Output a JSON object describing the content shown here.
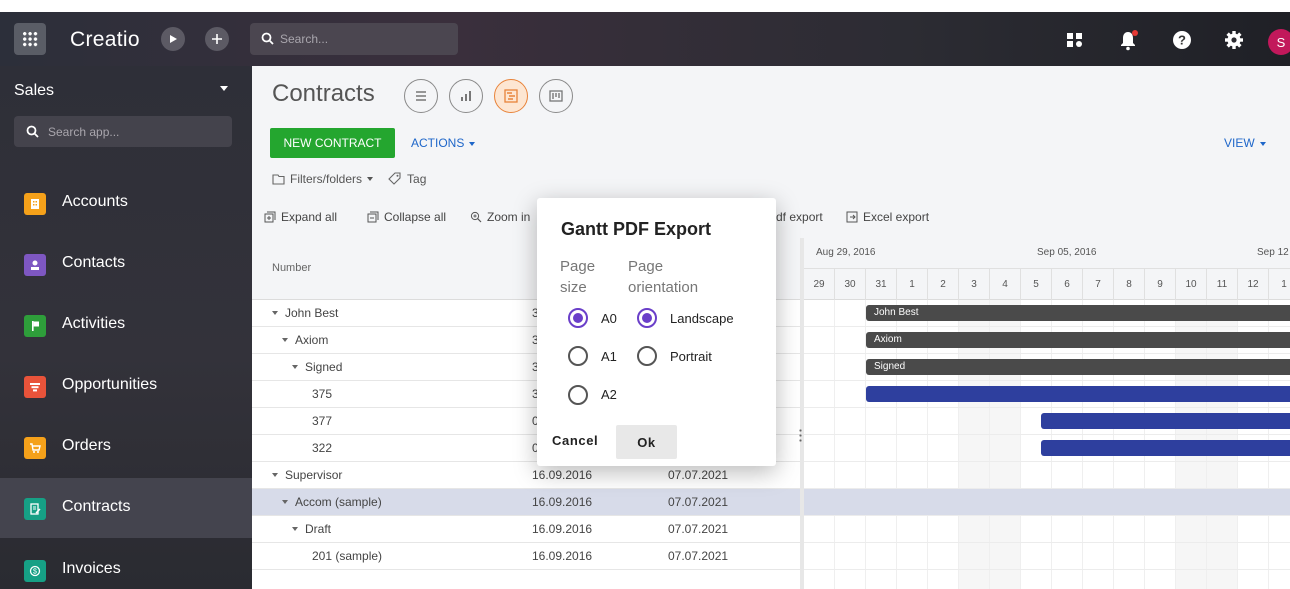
{
  "topbar": {
    "logo": "Creatio",
    "search_placeholder": "Search...",
    "avatar_initial": "S"
  },
  "sidebar": {
    "workspace": "Sales",
    "search_placeholder": "Search app...",
    "items": [
      {
        "label": "Accounts",
        "color": "#f5a11a",
        "icon": "building-icon"
      },
      {
        "label": "Contacts",
        "color": "#7e57c2",
        "icon": "person-icon"
      },
      {
        "label": "Activities",
        "color": "#2e9e3a",
        "icon": "flag-icon"
      },
      {
        "label": "Opportunities",
        "color": "#e8533a",
        "icon": "funnel-icon"
      },
      {
        "label": "Orders",
        "color": "#f5a11a",
        "icon": "cart-icon"
      },
      {
        "label": "Contracts",
        "color": "#16a085",
        "icon": "contract-icon"
      },
      {
        "label": "Invoices",
        "color": "#16a085",
        "icon": "invoice-icon"
      }
    ],
    "active": "Contracts"
  },
  "main": {
    "title": "Contracts",
    "new_button": "NEW CONTRACT",
    "actions": "ACTIONS",
    "view": "VIEW",
    "filters": "Filters/folders",
    "tag": "Tag",
    "toolbar": {
      "expand_all": "Expand all",
      "collapse_all": "Collapse all",
      "zoom_in": "Zoom in",
      "pdf_export": "df export",
      "excel_export": "Excel export"
    },
    "table": {
      "column_number": "Number",
      "rows": [
        {
          "name": "John Best",
          "level": 0,
          "d1": "3",
          "d2": "",
          "expanded": true
        },
        {
          "name": "Axiom",
          "level": 1,
          "d1": "3",
          "d2": "",
          "expanded": true
        },
        {
          "name": "Signed",
          "level": 2,
          "d1": "3",
          "d2": "",
          "expanded": true
        },
        {
          "name": "375",
          "level": 3,
          "d1": "3",
          "d2": ""
        },
        {
          "name": "377",
          "level": 3,
          "d1": "0",
          "d2": ""
        },
        {
          "name": "322",
          "level": 3,
          "d1": "0",
          "d2": ""
        },
        {
          "name": "Supervisor",
          "level": 0,
          "d1": "16.09.2016",
          "d2": "07.07.2021",
          "expanded": true
        },
        {
          "name": "Accom (sample)",
          "level": 1,
          "d1": "16.09.2016",
          "d2": "07.07.2021",
          "expanded": true,
          "selected": true
        },
        {
          "name": "Draft",
          "level": 2,
          "d1": "16.09.2016",
          "d2": "07.07.2021",
          "expanded": true
        },
        {
          "name": "201 (sample)",
          "level": 3,
          "d1": "16.09.2016",
          "d2": "07.07.2021"
        }
      ]
    },
    "gantt": {
      "weeks": [
        "Aug 29, 2016",
        "Sep 05, 2016",
        "Sep 12"
      ],
      "days": [
        "29",
        "30",
        "31",
        "1",
        "2",
        "3",
        "4",
        "5",
        "6",
        "7",
        "8",
        "9",
        "10",
        "11",
        "12",
        "1"
      ],
      "bars": [
        {
          "label": "John Best",
          "style": "dark"
        },
        {
          "label": "Axiom",
          "style": "dark"
        },
        {
          "label": "Signed",
          "style": "dark"
        },
        {
          "label": "",
          "style": "blue"
        },
        {
          "label": "",
          "style": "blue"
        },
        {
          "label": "",
          "style": "blue"
        }
      ]
    }
  },
  "dialog": {
    "title": "Gantt PDF Export",
    "page_size_label": "Page\nsize",
    "page_size_options": [
      "A0",
      "A1",
      "A2"
    ],
    "page_size_selected": "A0",
    "orientation_label": "Page\norientation",
    "orientation_options": [
      "Landscape",
      "Portrait"
    ],
    "orientation_selected": "Landscape",
    "cancel": "Cancel",
    "ok": "Ok"
  }
}
